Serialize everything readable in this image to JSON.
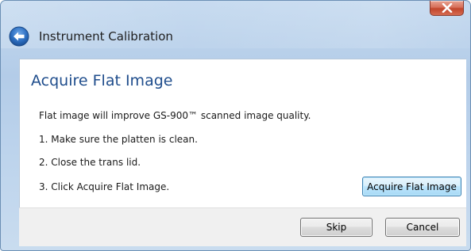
{
  "window": {
    "title": "Instrument Calibration",
    "close_icon": "close-x-icon",
    "back_icon": "back-arrow-icon"
  },
  "content": {
    "heading": "Acquire Flat Image",
    "intro": "Flat image will improve GS-900™ scanned image quality.",
    "steps": [
      "1. Make sure the platten is clean.",
      "2. Close the trans lid.",
      "3. Click Acquire Flat Image."
    ],
    "acquire_button_label": "Acquire Flat Image"
  },
  "footer": {
    "skip_label": "Skip",
    "cancel_label": "Cancel"
  },
  "colors": {
    "heading": "#1f4d8c",
    "title_bar": "#b9d1ea",
    "close_button": "#c7462c",
    "back_button": "#2e6fc1"
  }
}
